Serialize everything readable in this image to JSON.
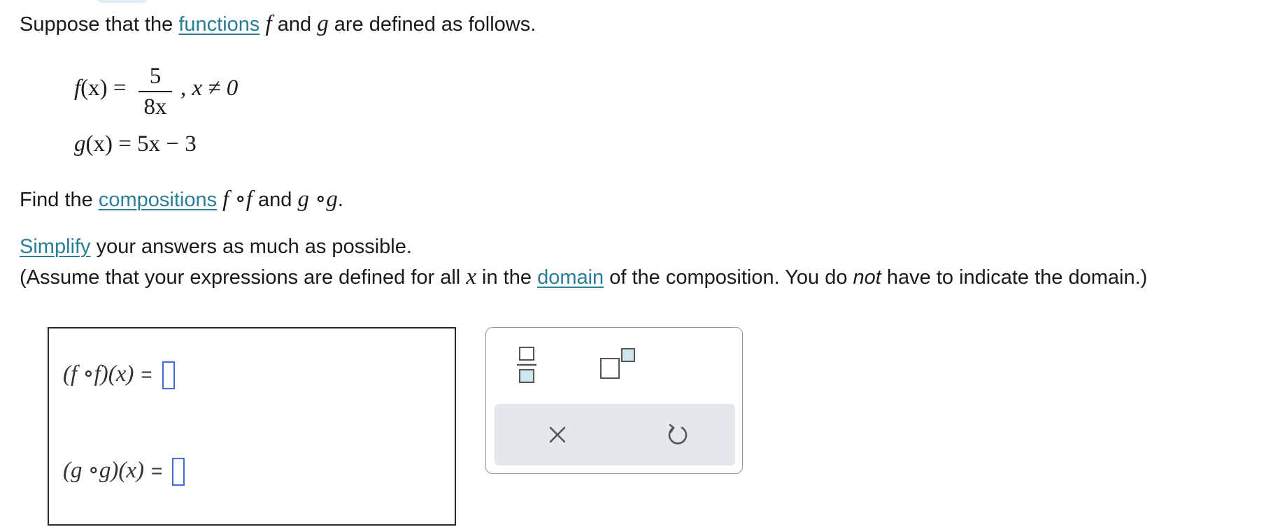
{
  "intro": {
    "before": "Suppose that the",
    "link_functions": "functions",
    "f": "f",
    "and": "and",
    "g": "g",
    "after": "are defined as follows."
  },
  "definitions": {
    "f_name": "f",
    "f_arg": "(x) =",
    "f_numerator": "5",
    "f_denominator": "8x",
    "f_condition": "x ≠ 0",
    "g_name": "g",
    "g_rhs": "(x) = 5x − 3"
  },
  "task": {
    "before": "Find the",
    "link_compositions": "compositions",
    "ff": "f ∘f",
    "and": "and",
    "gg": "g ∘g",
    "period": "."
  },
  "instructions": {
    "link_simplify": "Simplify",
    "line1_rest": "your answers as much as possible.",
    "line2_a": "(Assume that your expressions are defined for all",
    "line2_x": "x",
    "line2_b": "in the",
    "link_domain": "domain",
    "line2_c": "of the composition. You do",
    "line2_not": "not",
    "line2_d": "have to indicate the domain.)"
  },
  "answers": [
    {
      "label": "(f ∘f)(x)",
      "equals": "=",
      "value": ""
    },
    {
      "label": "(g ∘g)(x)",
      "equals": "=",
      "value": ""
    }
  ],
  "toolbar": {
    "fraction_tool": "fraction-icon",
    "exponent_tool": "exponent-icon",
    "clear_button": "×",
    "undo_button": "undo-icon"
  },
  "colors": {
    "link": "#2a7d96",
    "blank_border": "#3f6cd9",
    "tool_icon_fill": "#cfe6ee",
    "action_bar": "#e4e8eb"
  }
}
